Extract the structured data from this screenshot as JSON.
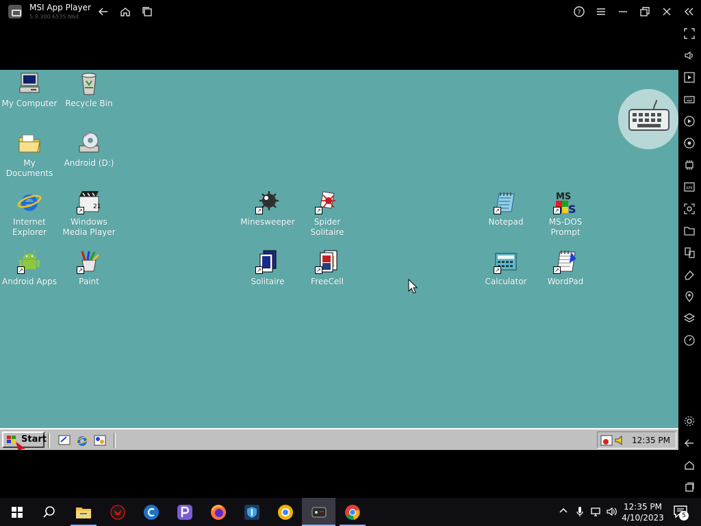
{
  "msi": {
    "title": "MSI App Player",
    "version": "5.9.300.6535 N64"
  },
  "desktop": {
    "icons": [
      {
        "label": "My Computer"
      },
      {
        "label": "Recycle Bin"
      },
      {
        "label": "My Documents"
      },
      {
        "label": "Android (D:)"
      },
      {
        "label": "Internet Explorer"
      },
      {
        "label": "Windows Media Player"
      },
      {
        "label": "Minesweeper"
      },
      {
        "label": "Spider Solitaire"
      },
      {
        "label": "Notepad"
      },
      {
        "label": "MS-DOS Prompt"
      },
      {
        "label": "Android Apps"
      },
      {
        "label": "Paint"
      },
      {
        "label": "Solitaire"
      },
      {
        "label": "FreeCell"
      },
      {
        "label": "Calculator"
      },
      {
        "label": "WordPad"
      }
    ]
  },
  "taskbar98": {
    "start_label": "Start",
    "clock": "12:35 PM"
  },
  "win10": {
    "time": "12:35 PM",
    "date": "4/10/2023",
    "notification_count": "5"
  },
  "colors": {
    "desktop_bg": "#5fa8a8",
    "win98_face": "#c0c0c0",
    "win10_taskbar": "#0f0f13"
  }
}
